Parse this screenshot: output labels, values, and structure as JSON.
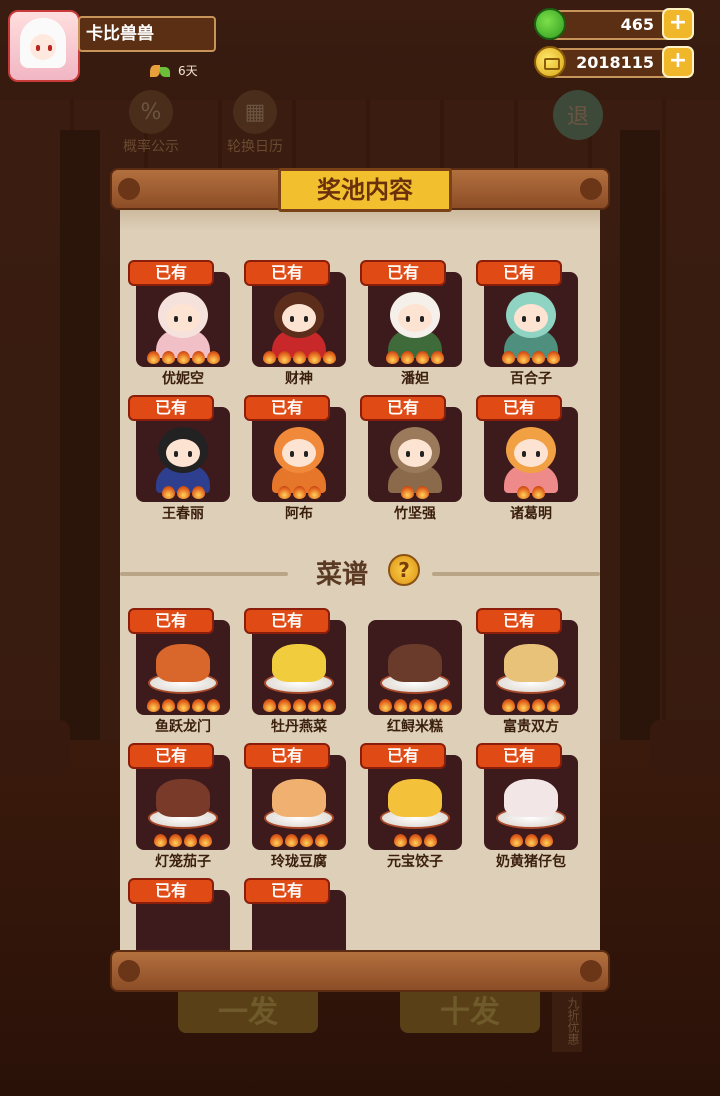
{
  "player": {
    "name": "卡比兽兽",
    "days": "6天"
  },
  "resources": {
    "apples": "465",
    "coins": "2018115"
  },
  "background": {
    "icon1_label": "概率公示",
    "icon2_label": "轮换日历",
    "icon1_glyph": "%",
    "icon3_glyph": "退",
    "btn1": "一发",
    "btn2": "十发",
    "tag": "九折优惠"
  },
  "dialog": {
    "title": "奖池内容",
    "owned_label": "已有",
    "recipe_section_title": "菜谱",
    "help_glyph": "?"
  },
  "characters": [
    {
      "name": "优妮空",
      "owned": true,
      "stars": 5,
      "color_head": "#f6e2dc",
      "color_body": "#f1c0c7"
    },
    {
      "name": "财神",
      "owned": true,
      "stars": 5,
      "color_head": "#5b2d1a",
      "color_body": "#c8282a"
    },
    {
      "name": "潘妲",
      "owned": true,
      "stars": 4,
      "color_head": "#f5f1ea",
      "color_body": "#3f6a3a"
    },
    {
      "name": "百合子",
      "owned": true,
      "stars": 4,
      "color_head": "#8fd3c2",
      "color_body": "#4e8f7d"
    },
    {
      "name": "王春丽",
      "owned": true,
      "stars": 3,
      "color_head": "#222222",
      "color_body": "#2e3f8f"
    },
    {
      "name": "阿布",
      "owned": true,
      "stars": 3,
      "color_head": "#f08a3a",
      "color_body": "#e6772a"
    },
    {
      "name": "竹坚强",
      "owned": true,
      "stars": 2,
      "color_head": "#9a7a5a",
      "color_body": "#8a6a4a"
    },
    {
      "name": "诸葛明",
      "owned": true,
      "stars": 2,
      "color_head": "#f1a043",
      "color_body": "#ef8a8a"
    }
  ],
  "recipes": [
    {
      "name": "鱼跃龙门",
      "owned": true,
      "stars": 5,
      "color": "#d9662a"
    },
    {
      "name": "牡丹燕菜",
      "owned": true,
      "stars": 5,
      "color": "#f1cc3c"
    },
    {
      "name": "红鲟米糕",
      "owned": false,
      "stars": 5,
      "color": "#6a3a2a"
    },
    {
      "name": "富贵双方",
      "owned": true,
      "stars": 4,
      "color": "#e9c27a"
    },
    {
      "name": "灯笼茄子",
      "owned": true,
      "stars": 4,
      "color": "#7a3a2a"
    },
    {
      "name": "玲珑豆腐",
      "owned": true,
      "stars": 4,
      "color": "#f0b070"
    },
    {
      "name": "元宝饺子",
      "owned": true,
      "stars": 3,
      "color": "#f4c23a"
    },
    {
      "name": "奶黄猪仔包",
      "owned": true,
      "stars": 3,
      "color": "#f3e6e6"
    },
    {
      "name": "",
      "owned": true,
      "stars": 0,
      "color": "#3d1a1c"
    },
    {
      "name": "",
      "owned": true,
      "stars": 0,
      "color": "#3d1a1c"
    }
  ]
}
